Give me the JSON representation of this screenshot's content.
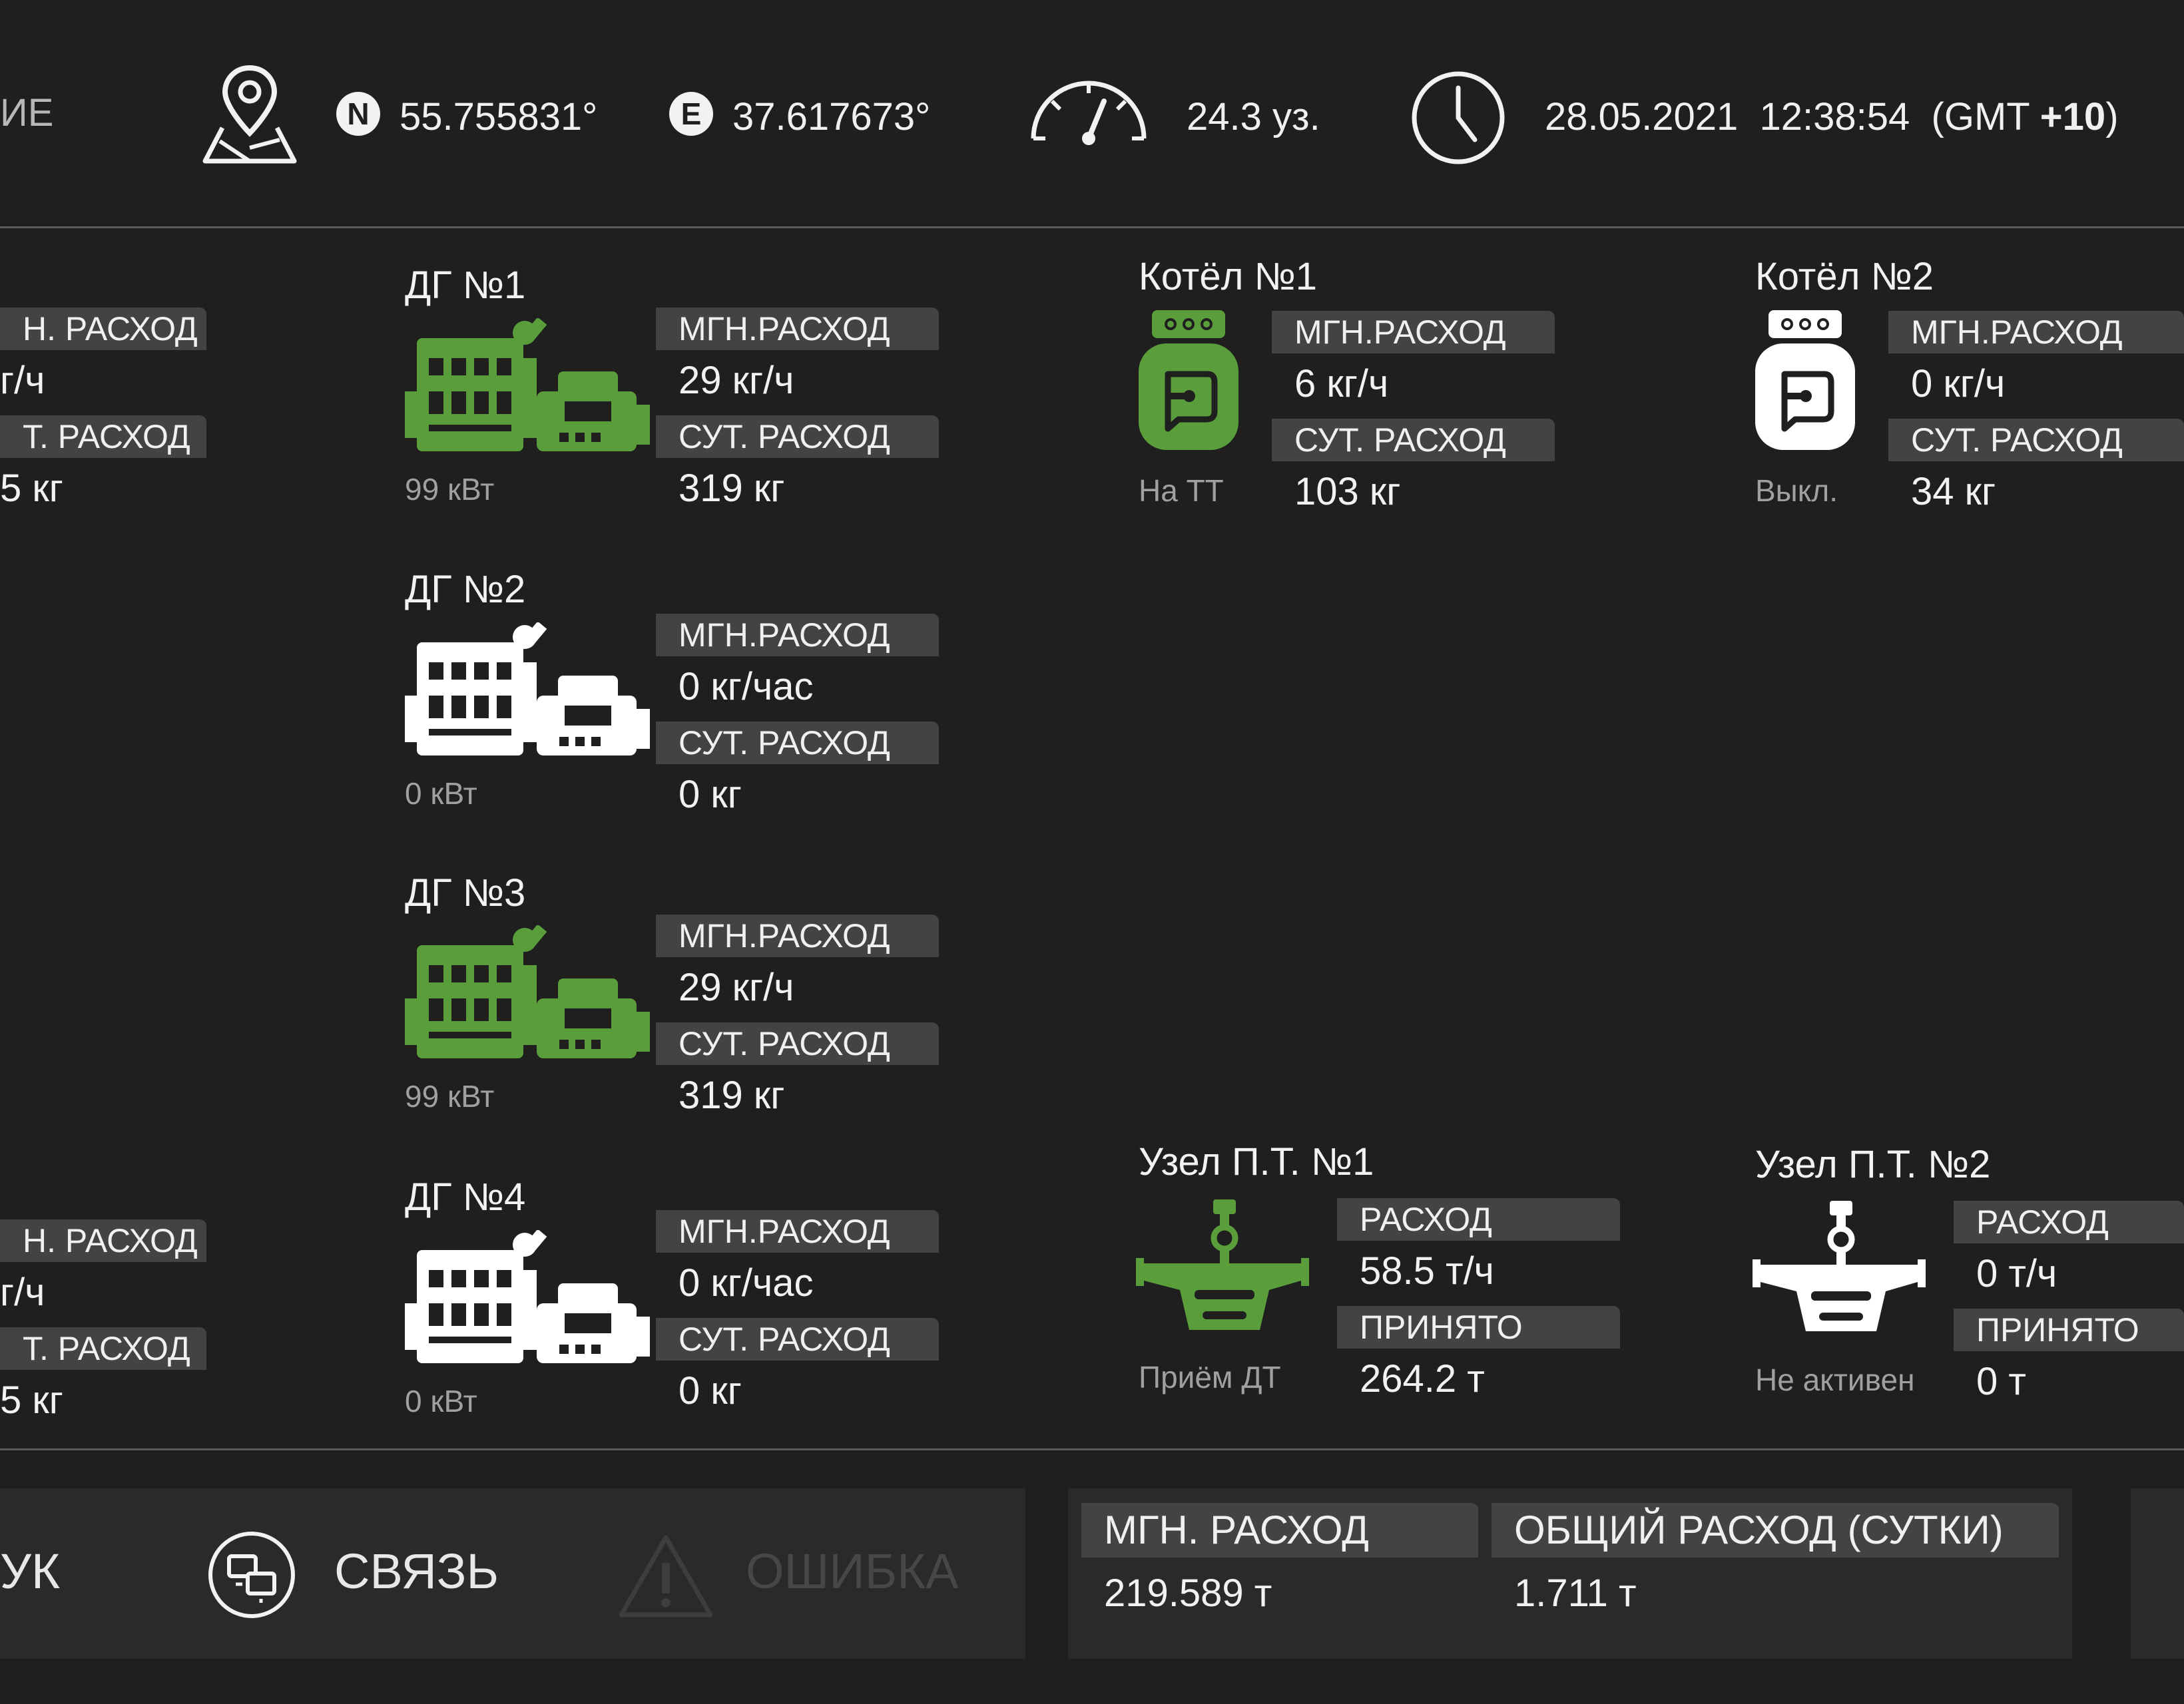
{
  "header": {
    "left_cut_label": "ИЕ",
    "lat_badge": "N",
    "latitude": "55.755831°",
    "lon_badge": "E",
    "longitude": "37.617673°",
    "speed": "24.3 уз.",
    "date": "28.05.2021",
    "time": "12:38:54",
    "tz_prefix": "(GMT ",
    "tz_offset": "+10",
    "tz_suffix": ")"
  },
  "left_partial": {
    "top": {
      "tag1": "Н. РАСХОД",
      "val1": "г/ч",
      "tag2": "Т. РАСХОД",
      "val2": "5 кг"
    },
    "bottom": {
      "tag1": "Н. РАСХОД",
      "val1": "г/ч",
      "tag2": "Т. РАСХОД",
      "val2": "5 кг"
    }
  },
  "generators": [
    {
      "title": "ДГ №1",
      "state": "active",
      "power": "99  кВт",
      "tag1": "МГН.РАСХОД",
      "val1": "29 кг/ч",
      "tag2": "СУТ. РАСХОД",
      "val2": "319 кг"
    },
    {
      "title": "ДГ №2",
      "state": "inactive",
      "power": "0 кВт",
      "tag1": "МГН.РАСХОД",
      "val1": "0 кг/час",
      "tag2": "СУТ. РАСХОД",
      "val2": "0 кг"
    },
    {
      "title": "ДГ №3",
      "state": "active",
      "power": "99  кВт",
      "tag1": "МГН.РАСХОД",
      "val1": "29 кг/ч",
      "tag2": "СУТ. РАСХОД",
      "val2": "319 кг"
    },
    {
      "title": "ДГ №4",
      "state": "inactive",
      "power": "0 кВт",
      "tag1": "МГН.РАСХОД",
      "val1": "0 кг/час",
      "tag2": "СУТ. РАСХОД",
      "val2": "0 кг"
    }
  ],
  "boilers": [
    {
      "title": "Котёл №1",
      "state": "active",
      "status": "На ТТ",
      "tag1": "МГН.РАСХОД",
      "val1": "6 кг/ч",
      "tag2": "СУТ. РАСХОД",
      "val2": "103 кг"
    },
    {
      "title": "Котёл №2",
      "state": "inactive",
      "status": "Выкл.",
      "tag1": "МГН.РАСХОД",
      "val1": "0 кг/ч",
      "tag2": "СУТ. РАСХОД",
      "val2": "34 кг"
    }
  ],
  "nodes": [
    {
      "title": "Узел П.Т. №1",
      "state": "active",
      "status": "Приём ДТ",
      "tag1": "РАСХОД",
      "val1": "58.5 т/ч",
      "tag2": "ПРИНЯТО",
      "val2": "264.2 т"
    },
    {
      "title": "Узел П.Т. №2",
      "state": "inactive",
      "status": "Не активен",
      "tag1": "РАСХОД",
      "val1": "0 т/ч",
      "tag2": "ПРИНЯТО",
      "val2": "0 т"
    }
  ],
  "bottom": {
    "left_cut_label": "УК",
    "connection_label": "СВЯЗЬ",
    "error_label": "ОШИБКА",
    "instant_tag": "МГН. РАСХОД",
    "instant_value": "219.589 т",
    "total_tag": "ОБЩИЙ РАСХОД (СУТКИ)",
    "total_value": "1.711 т"
  },
  "colors": {
    "active": "#5a9e3c",
    "inactive": "#ffffff",
    "background": "#1f1f1f",
    "tag": "#434343"
  }
}
